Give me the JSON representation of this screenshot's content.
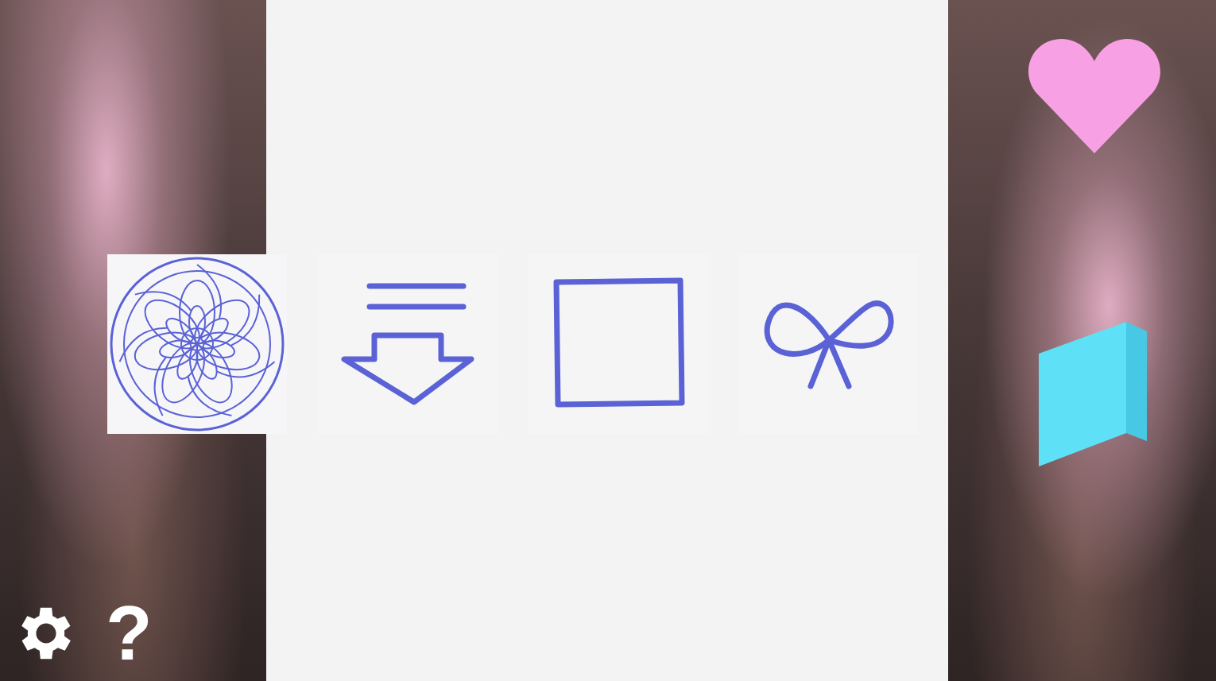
{
  "tiles": [
    {
      "kind": "mandala",
      "selected": true
    },
    {
      "kind": "arrow",
      "selected": false
    },
    {
      "kind": "square",
      "selected": false
    },
    {
      "kind": "bow",
      "selected": false
    }
  ],
  "help": {
    "label": "?"
  }
}
